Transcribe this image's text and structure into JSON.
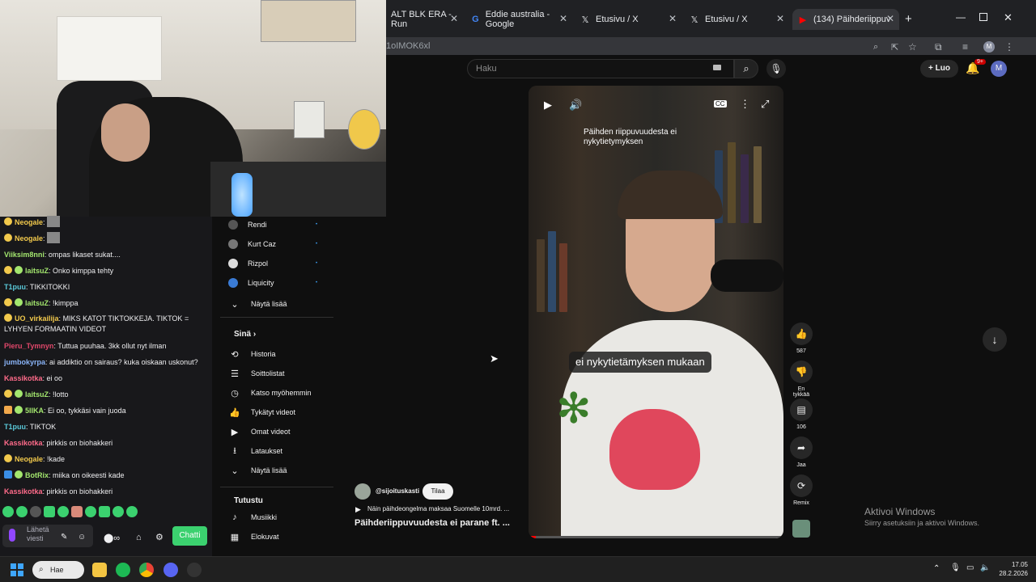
{
  "browser": {
    "tabs": [
      {
        "label": "ALT BLK ERA - Run"
      },
      {
        "label": "Eddie australia - Google"
      },
      {
        "label": "Etusivu / X"
      },
      {
        "label": "Etusivu / X"
      },
      {
        "label": "(134) Päihderiippuvuude",
        "active": true
      }
    ],
    "url": "1oIMOK6xl"
  },
  "youtube": {
    "search_placeholder": "Haku",
    "create_label": "Luo",
    "notification_count": "9+",
    "avatar_letter": "M",
    "sidebar": {
      "subscriptions": [
        "Rendi",
        "Kurt Caz",
        "Rizpol",
        "Liquicity"
      ],
      "show_more": "Näytä lisää",
      "you_heading": "Sinä",
      "you_items": [
        "Historia",
        "Soittolistat",
        "Katso myöhemmin",
        "Tykätyt videot",
        "Omat videot",
        "Lataukset",
        "Näytä lisää"
      ],
      "explore_heading": "Tutustu",
      "explore_items": [
        "Musiikki",
        "Elokuvat"
      ]
    },
    "player": {
      "caption_top": "Päihden riippuvuudesta ei nykytietymyksen",
      "caption_mid": "ei nykytietämyksen mukaan"
    },
    "actions": {
      "like_count": "587",
      "dislike_label": "En tykkää",
      "comments_count": "106",
      "share_label": "Jaa",
      "remix_label": "Remix"
    },
    "video": {
      "channel": "@sijoituskasti",
      "subscribe_label": "Tilaa",
      "subtitle": "Näin päihdeongelma maksaa Suomelle 10mrd. ...",
      "title": "Päihderiippuvuudesta ei parane ft. ..."
    }
  },
  "chat": {
    "messages": [
      {
        "user": "Neogale",
        "text": "",
        "color": "#f2c94c"
      },
      {
        "user": "Neogale",
        "text": "",
        "color": "#f2c94c"
      },
      {
        "user": "Viiksim8nni",
        "text": "ompas likaset sukat....",
        "color": "#a3e66e"
      },
      {
        "user": "laitsuZ",
        "text": "Onko kimppa tehty",
        "color": "#a3e66e"
      },
      {
        "user": "T1puu",
        "text": "TIKKITOKKI",
        "color": "#5ac8d8"
      },
      {
        "user": "laitsuZ",
        "text": "!kimppa",
        "color": "#a3e66e"
      },
      {
        "user": "UO_virkailija",
        "text": "MIKS KATOT TIKTOKKEJA. TIKTOK = LYHYEN FORMAATIN VIDEOT",
        "color": "#f2c94c"
      },
      {
        "user": "Pieru_Tymnyn",
        "text": "Tuttua puuhaa. 3kk ollut nyt ilman",
        "color": "#e0476a"
      },
      {
        "user": "jumbokyrpa",
        "text": "ai addiktio on sairaus? kuka oiskaan uskonut?",
        "color": "#8ab4f8"
      },
      {
        "user": "Kassikotka",
        "text": "ei oo",
        "color": "#ff6b8a"
      },
      {
        "user": "laitsuZ",
        "text": "!lotto",
        "color": "#a3e66e"
      },
      {
        "user": "5IIKA",
        "text": "Ei oo, tykkäsi vain juoda",
        "color": "#a3e66e"
      },
      {
        "user": "T1puu",
        "text": "TIKTOK",
        "color": "#5ac8d8"
      },
      {
        "user": "Kassikotka",
        "text": "pirkkis on biohakkeri",
        "color": "#ff6b8a"
      },
      {
        "user": "Neogale",
        "text": "!kade",
        "color": "#f2c94c"
      },
      {
        "user": "BotRix",
        "text": "miika on oikeesti kade",
        "color": "#a3e66e"
      },
      {
        "user": "Kassikotka",
        "text": "pirkkis on biohakkeri",
        "color": "#ff6b8a"
      }
    ],
    "input_placeholder": "Lähetä viesti",
    "chat_button": "Chatti"
  },
  "windows": {
    "search_label": "Hae",
    "activation_title": "Aktivoi Windows",
    "activation_sub": "Siirry asetuksiin ja aktivoi Windows.",
    "time": "17.05",
    "date": "28.2.2026"
  }
}
